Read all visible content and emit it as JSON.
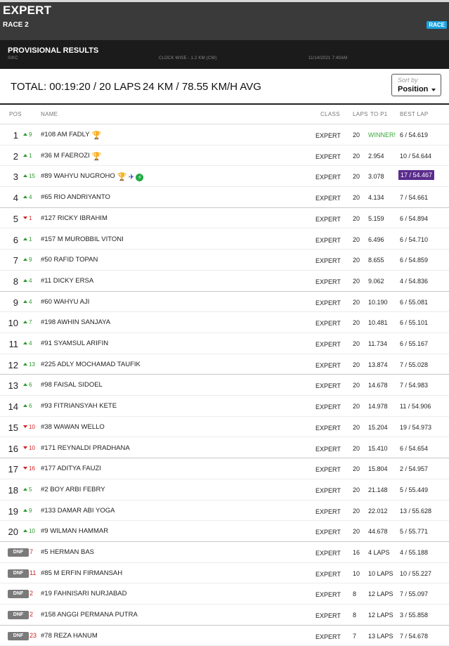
{
  "header": {
    "title": "EXPERT",
    "race": "RACE 2",
    "badge": "RACE"
  },
  "provisional": {
    "label": "PROVISIONAL RESULTS",
    "circuit": "SIKC",
    "track": "CLOCK WISE - 1.2 KM (CW)",
    "datetime": "11/14/2021 7:40AM"
  },
  "summary": {
    "total": "TOTAL: 00:19:20 / 20 LAPS",
    "distance": "24 KM / 78.55 KM/H AVG"
  },
  "sort": {
    "label": "Sort by",
    "value": "Position"
  },
  "columns": {
    "pos": "POS",
    "name": "NAME",
    "class": "CLASS",
    "laps": "LAPS",
    "gap": "TO P1",
    "best": "BEST LAP"
  },
  "colors": {
    "up": "#2b9a2b",
    "down": "#d42020",
    "winner": "#3aa83a",
    "fastest": "#5a2c8c"
  },
  "rows": [
    {
      "pos": "1",
      "dir": "up",
      "change": "9",
      "name": "#108 AM FADLY",
      "trophy": "gold-trophy-icon",
      "class": "EXPERT",
      "laps": "20",
      "gap": "WINNER!",
      "best": "6 / 54.619"
    },
    {
      "pos": "2",
      "dir": "up",
      "change": "1",
      "name": "#36 M FAEROZI",
      "trophy": "silver-trophy-icon",
      "class": "EXPERT",
      "laps": "20",
      "gap": "2.954",
      "best": "10 / 54.644"
    },
    {
      "pos": "3",
      "dir": "up",
      "change": "15",
      "name": "#89 WAHYU NUGROHO",
      "trophy": "bronze-trophy-icon",
      "class": "EXPERT",
      "laps": "20",
      "gap": "3.078",
      "best": "17 / 54.467",
      "fastest": true
    },
    {
      "pos": "4",
      "dir": "up",
      "change": "4",
      "name": "#65 RIO ANDRIYANTO",
      "class": "EXPERT",
      "laps": "20",
      "gap": "4.134",
      "best": "7 / 54.661"
    },
    {
      "pos": "5",
      "dir": "down",
      "change": "1",
      "name": "#127 RICKY IBRAHIM",
      "class": "EXPERT",
      "laps": "20",
      "gap": "5.159",
      "best": "6 / 54.894"
    },
    {
      "pos": "6",
      "dir": "up",
      "change": "1",
      "name": "#157 M MUROBBIL VITONI",
      "class": "EXPERT",
      "laps": "20",
      "gap": "6.496",
      "best": "6 / 54.710"
    },
    {
      "pos": "7",
      "dir": "up",
      "change": "9",
      "name": "#50 RAFID TOPAN",
      "class": "EXPERT",
      "laps": "20",
      "gap": "8.655",
      "best": "6 / 54.859"
    },
    {
      "pos": "8",
      "dir": "up",
      "change": "4",
      "name": "#11 DICKY ERSA",
      "class": "EXPERT",
      "laps": "20",
      "gap": "9.062",
      "best": "4 / 54.836"
    },
    {
      "pos": "9",
      "dir": "up",
      "change": "4",
      "name": "#60 WAHYU AJI",
      "class": "EXPERT",
      "laps": "20",
      "gap": "10.190",
      "best": "6 / 55.081"
    },
    {
      "pos": "10",
      "dir": "up",
      "change": "7",
      "name": "#198 AWHIN SANJAYA",
      "class": "EXPERT",
      "laps": "20",
      "gap": "10.481",
      "best": "6 / 55.101"
    },
    {
      "pos": "11",
      "dir": "up",
      "change": "4",
      "name": "#91 SYAMSUL ARIFIN",
      "class": "EXPERT",
      "laps": "20",
      "gap": "11.734",
      "best": "6 / 55.167"
    },
    {
      "pos": "12",
      "dir": "up",
      "change": "13",
      "name": "#225 ADLY MOCHAMAD TAUFIK",
      "class": "EXPERT",
      "laps": "20",
      "gap": "13.874",
      "best": "7 / 55.028"
    },
    {
      "pos": "13",
      "dir": "up",
      "change": "6",
      "name": "#98 FAISAL SIDOEL",
      "class": "EXPERT",
      "laps": "20",
      "gap": "14.678",
      "best": "7 / 54.983"
    },
    {
      "pos": "14",
      "dir": "up",
      "change": "6",
      "name": "#93 FITRIANSYAH KETE",
      "class": "EXPERT",
      "laps": "20",
      "gap": "14.978",
      "best": "11 / 54.906"
    },
    {
      "pos": "15",
      "dir": "down",
      "change": "10",
      "name": "#38 WAWAN WELLO",
      "class": "EXPERT",
      "laps": "20",
      "gap": "15.204",
      "best": "19 / 54.973"
    },
    {
      "pos": "16",
      "dir": "down",
      "change": "10",
      "name": "#171 REYNALDI PRADHANA",
      "class": "EXPERT",
      "laps": "20",
      "gap": "15.410",
      "best": "6 / 54.654"
    },
    {
      "pos": "17",
      "dir": "down",
      "change": "16",
      "name": "#177 ADITYA FAUZI",
      "class": "EXPERT",
      "laps": "20",
      "gap": "15.804",
      "best": "2 / 54.957"
    },
    {
      "pos": "18",
      "dir": "up",
      "change": "5",
      "name": "#2 BOY ARBI FEBRY",
      "class": "EXPERT",
      "laps": "20",
      "gap": "21.148",
      "best": "5 / 55.449"
    },
    {
      "pos": "19",
      "dir": "up",
      "change": "9",
      "name": "#133 DAMAR ABI YOGA",
      "class": "EXPERT",
      "laps": "20",
      "gap": "22.012",
      "best": "13 / 55.628"
    },
    {
      "pos": "20",
      "dir": "up",
      "change": "10",
      "name": "#9 WILMAN HAMMAR",
      "class": "EXPERT",
      "laps": "20",
      "gap": "44.678",
      "best": "5 / 55.771"
    },
    {
      "pos": "DNF",
      "dnf": true,
      "change": "7",
      "name": "#5 HERMAN BAS",
      "class": "EXPERT",
      "laps": "16",
      "gap": "4 LAPS",
      "best": "4 / 55.188"
    },
    {
      "pos": "DNF",
      "dnf": true,
      "change": "11",
      "name": "#85 M ERFIN FIRMANSAH",
      "class": "EXPERT",
      "laps": "10",
      "gap": "10 LAPS",
      "best": "10 / 55.227"
    },
    {
      "pos": "DNF",
      "dnf": true,
      "change": "2",
      "name": "#19 FAHNISARI NURJABAD",
      "class": "EXPERT",
      "laps": "8",
      "gap": "12 LAPS",
      "best": "7 / 55.097"
    },
    {
      "pos": "DNF",
      "dnf": true,
      "change": "2",
      "name": "#158 ANGGI PERMANA PUTRA",
      "class": "EXPERT",
      "laps": "8",
      "gap": "12 LAPS",
      "best": "3 / 55.858"
    },
    {
      "pos": "DNF",
      "dnf": true,
      "change": "23",
      "name": "#78 REZA HANUM",
      "class": "EXPERT",
      "laps": "7",
      "gap": "13 LAPS",
      "best": "7 / 54.678"
    }
  ]
}
